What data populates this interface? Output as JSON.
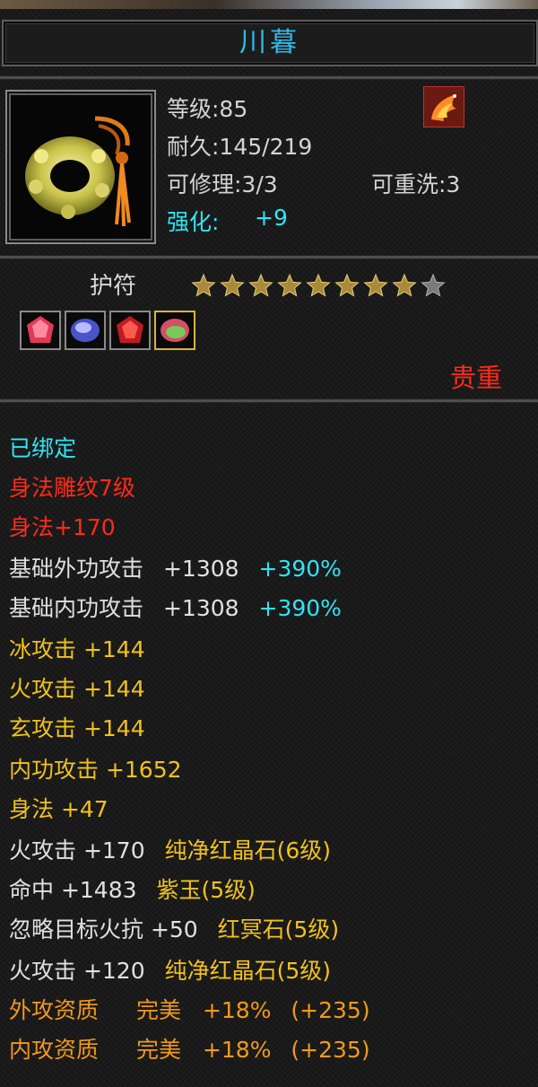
{
  "item": {
    "name": "川暮",
    "level": "等级:85",
    "durability": "耐久:145/219",
    "repairable": "可修理:3/3",
    "rewash": "可重洗:3",
    "enhance_label": "强化:",
    "enhance_value": "+9"
  },
  "type_label": "护符",
  "star_rating": {
    "filled": 8,
    "total": 9
  },
  "rarity": "贵重",
  "colors": {
    "title": "#2fb8e8",
    "cyan": "#2fe4f4",
    "red": "#ff2a1a",
    "yellow": "#f0c21a",
    "orange": "#f29a18"
  },
  "gems": [
    "red-gem-icon",
    "blue-gem-icon",
    "red-gem-icon",
    "green-gem-icon"
  ],
  "attributes": {
    "bound": "已绑定",
    "carving": "身法雕纹7级",
    "carving_bonus": "身法+170",
    "base_ext_atk": "基础外功攻击",
    "base_ext_atk_val": "+1308",
    "base_ext_atk_pct": "+390%",
    "base_int_atk": "基础内功攻击",
    "base_int_atk_val": "+1308",
    "base_int_atk_pct": "+390%",
    "ice_atk": "冰攻击 +144",
    "fire_atk": "火攻击 +144",
    "xuan_atk": "玄攻击 +144",
    "int_atk": "内功攻击 +1652",
    "agility": "身法 +47",
    "gem1_stat": "火攻击 +170",
    "gem1_name": "纯净红晶石(6级)",
    "gem2_stat": "命中 +1483",
    "gem2_name": "紫玉(5级)",
    "gem3_stat": "忽略目标火抗 +50",
    "gem3_name": "红冥石(5级)",
    "gem4_stat": "火攻击 +120",
    "gem4_name": "纯净红晶石(5级)",
    "ext_quality": "外攻资质",
    "ext_quality_grade": "完美",
    "ext_quality_val": "+18%",
    "ext_quality_bonus": "(+235)",
    "int_quality": "内攻资质",
    "int_quality_grade": "完美",
    "int_quality_val": "+18%",
    "int_quality_bonus": "(+235)"
  }
}
